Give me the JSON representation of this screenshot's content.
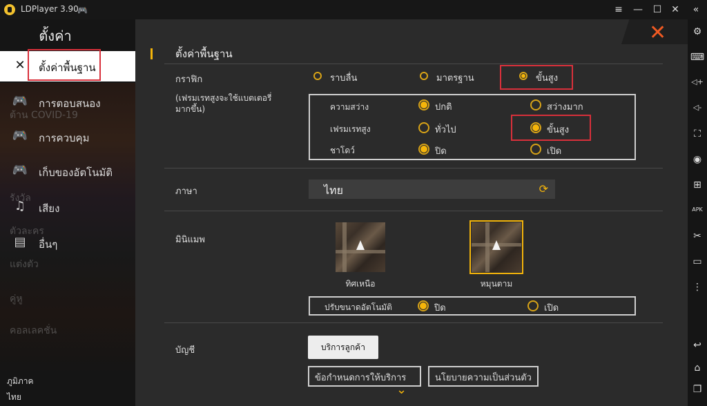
{
  "app": {
    "title": "LDPlayer 3.90"
  },
  "window_controls": {
    "menu": "≡",
    "minimize": "—",
    "maximize": "☐",
    "close": "✕",
    "collapse": "«"
  },
  "sidebar": {
    "title": "ตั้งค่า",
    "items": [
      {
        "label": "ตั้งค่าพื้นฐาน",
        "icon": "wrench-screwdriver-icon"
      },
      {
        "label": "การตอบสนอง",
        "icon": "gamepad-icon"
      },
      {
        "label": "การควบคุม",
        "icon": "gamepad-icon"
      },
      {
        "label": "เก็บของอัตโนมัติ",
        "icon": "gamepad-icon"
      },
      {
        "label": "เสียง",
        "icon": "music-note-icon"
      },
      {
        "label": "อื่นๆ",
        "icon": "document-icon"
      }
    ],
    "background_texts": [
      "ต้าน COVID-19",
      "รังวัล",
      "ตัวละคร",
      "แต่งตัว",
      "คู่หู",
      "คอลเลคชั่น"
    ],
    "region_label": "ภูมิภาค",
    "region_value": "ไทย"
  },
  "main": {
    "close_icon": "✕",
    "section_title": "ตั้งค่าพื้นฐาน",
    "graphics": {
      "label": "กราฟิก",
      "note": "(เฟรมเรทสูงจะใช้แบตเตอรี่มากขึ้น)",
      "options": [
        "ราบลื่น",
        "มาตรฐาน",
        "ขั้นสูง"
      ],
      "selected": "ขั้นสูง",
      "sub": {
        "brightness": {
          "label": "ความสว่าง",
          "options": [
            "ปกติ",
            "สว่างมาก"
          ],
          "selected": "ปกติ"
        },
        "framerate": {
          "label": "เฟรมเรทสูง",
          "options": [
            "ทั่วไป",
            "ขั้นสูง"
          ],
          "selected": "ขั้นสูง"
        },
        "shadow": {
          "label": "ชาโดว์",
          "options": [
            "ปิด",
            "เปิด"
          ],
          "selected": "ปิด"
        }
      }
    },
    "language": {
      "label": "ภาษา",
      "value": "ไทย"
    },
    "minimap": {
      "label": "มินิแมพ",
      "options": [
        "ทิศเหนือ",
        "หมุนตาม"
      ],
      "selected": "หมุนตาม",
      "auto_resize": {
        "label": "ปรับขนาดอัตโนมัติ",
        "options": [
          "ปิด",
          "เปิด"
        ],
        "selected": "ปิด"
      }
    },
    "account": {
      "label": "บัญชี",
      "service_button": "บริการลูกค้า",
      "terms_button": "ข้อกำหนดการให้บริการ",
      "privacy_button": "นโยบายความเป็นส่วนตัว"
    },
    "scroll_chevron": "⌄"
  },
  "right_toolbar": {
    "icons": [
      "gear-icon",
      "keyboard-icon",
      "volume-up-icon",
      "volume-down-icon",
      "fullscreen-icon",
      "record-icon",
      "add-app-icon",
      "apk-icon",
      "scissors-icon",
      "video-icon",
      "more-icon",
      "back-icon",
      "home-icon",
      "recent-apps-icon"
    ],
    "glyphs": [
      "⚙",
      "⌨",
      "◁+",
      "◁-",
      "⛶",
      "◉",
      "⊞",
      "APK",
      "✂",
      "▭",
      "⋮",
      "↩",
      "⌂",
      "❐"
    ]
  },
  "colors": {
    "accent": "#f5b50a",
    "highlight_red": "#d9303b",
    "close_orange": "#f05a22"
  }
}
